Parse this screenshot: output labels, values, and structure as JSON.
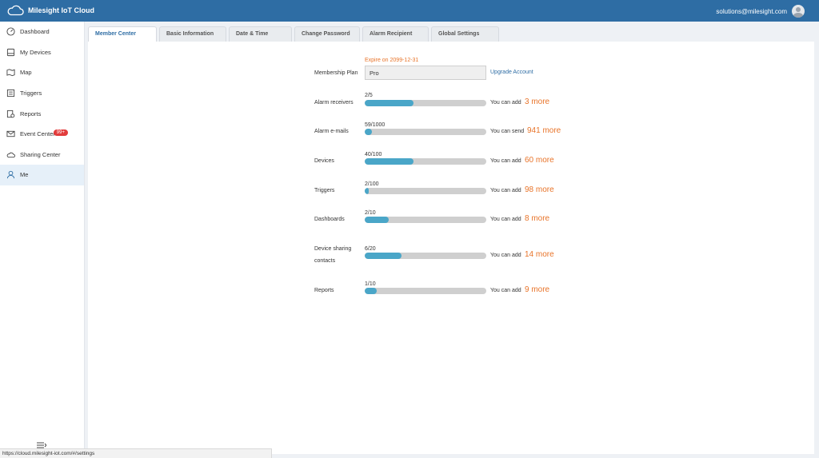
{
  "app": {
    "title": "Milesight IoT Cloud"
  },
  "user": {
    "email": "solutions@milesight.com"
  },
  "sidebar": {
    "items": [
      {
        "label": "Dashboard",
        "icon": "dashboard-icon"
      },
      {
        "label": "My Devices",
        "icon": "devices-icon"
      },
      {
        "label": "Map",
        "icon": "map-icon"
      },
      {
        "label": "Triggers",
        "icon": "triggers-icon"
      },
      {
        "label": "Reports",
        "icon": "reports-icon"
      },
      {
        "label": "Event Center",
        "icon": "mail-icon",
        "badge": "99+"
      },
      {
        "label": "Sharing Center",
        "icon": "cloud-icon"
      },
      {
        "label": "Me",
        "icon": "user-icon",
        "active": true
      }
    ]
  },
  "tabs": [
    {
      "label": "Member Center",
      "active": true
    },
    {
      "label": "Basic Information"
    },
    {
      "label": "Date & Time"
    },
    {
      "label": "Change Password"
    },
    {
      "label": "Alarm Recipient"
    },
    {
      "label": "Global Settings"
    }
  ],
  "membership": {
    "expire": "Expire on 2099-12-31",
    "plan_label": "Membership Plan",
    "plan_value": "Pro",
    "upgrade_label": "Upgrade Account"
  },
  "quotas": [
    {
      "label": "Alarm receivers",
      "ratio": "2/5",
      "used": 2,
      "total": 5,
      "hint": "You can add",
      "more": "3 more"
    },
    {
      "label": "Alarm e-mails",
      "ratio": "59/1000",
      "used": 59,
      "total": 1000,
      "hint": "You can send",
      "more": "941 more"
    },
    {
      "label": "Devices",
      "ratio": "40/100",
      "used": 40,
      "total": 100,
      "hint": "You can add",
      "more": "60 more"
    },
    {
      "label": "Triggers",
      "ratio": "2/100",
      "used": 2,
      "total": 100,
      "hint": "You can add",
      "more": "98 more"
    },
    {
      "label": "Dashboards",
      "ratio": "2/10",
      "used": 2,
      "total": 10,
      "hint": "You can add",
      "more": "8 more"
    },
    {
      "label_line1": "Device sharing",
      "label_line2": "contacts",
      "ratio": "6/20",
      "used": 6,
      "total": 20,
      "hint": "You can add",
      "more": "14 more"
    },
    {
      "label": "Reports",
      "ratio": "1/10",
      "used": 1,
      "total": 10,
      "hint": "You can add",
      "more": "9 more"
    }
  ],
  "status_bar": {
    "url": "https://cloud.milesight-iot.com/#/settings"
  },
  "colors": {
    "header": "#2e6da4",
    "accent": "#e8742a",
    "bar_fill": "#4aa6c8",
    "bar_track": "#cfcfcf",
    "badge": "#e23c3c"
  }
}
